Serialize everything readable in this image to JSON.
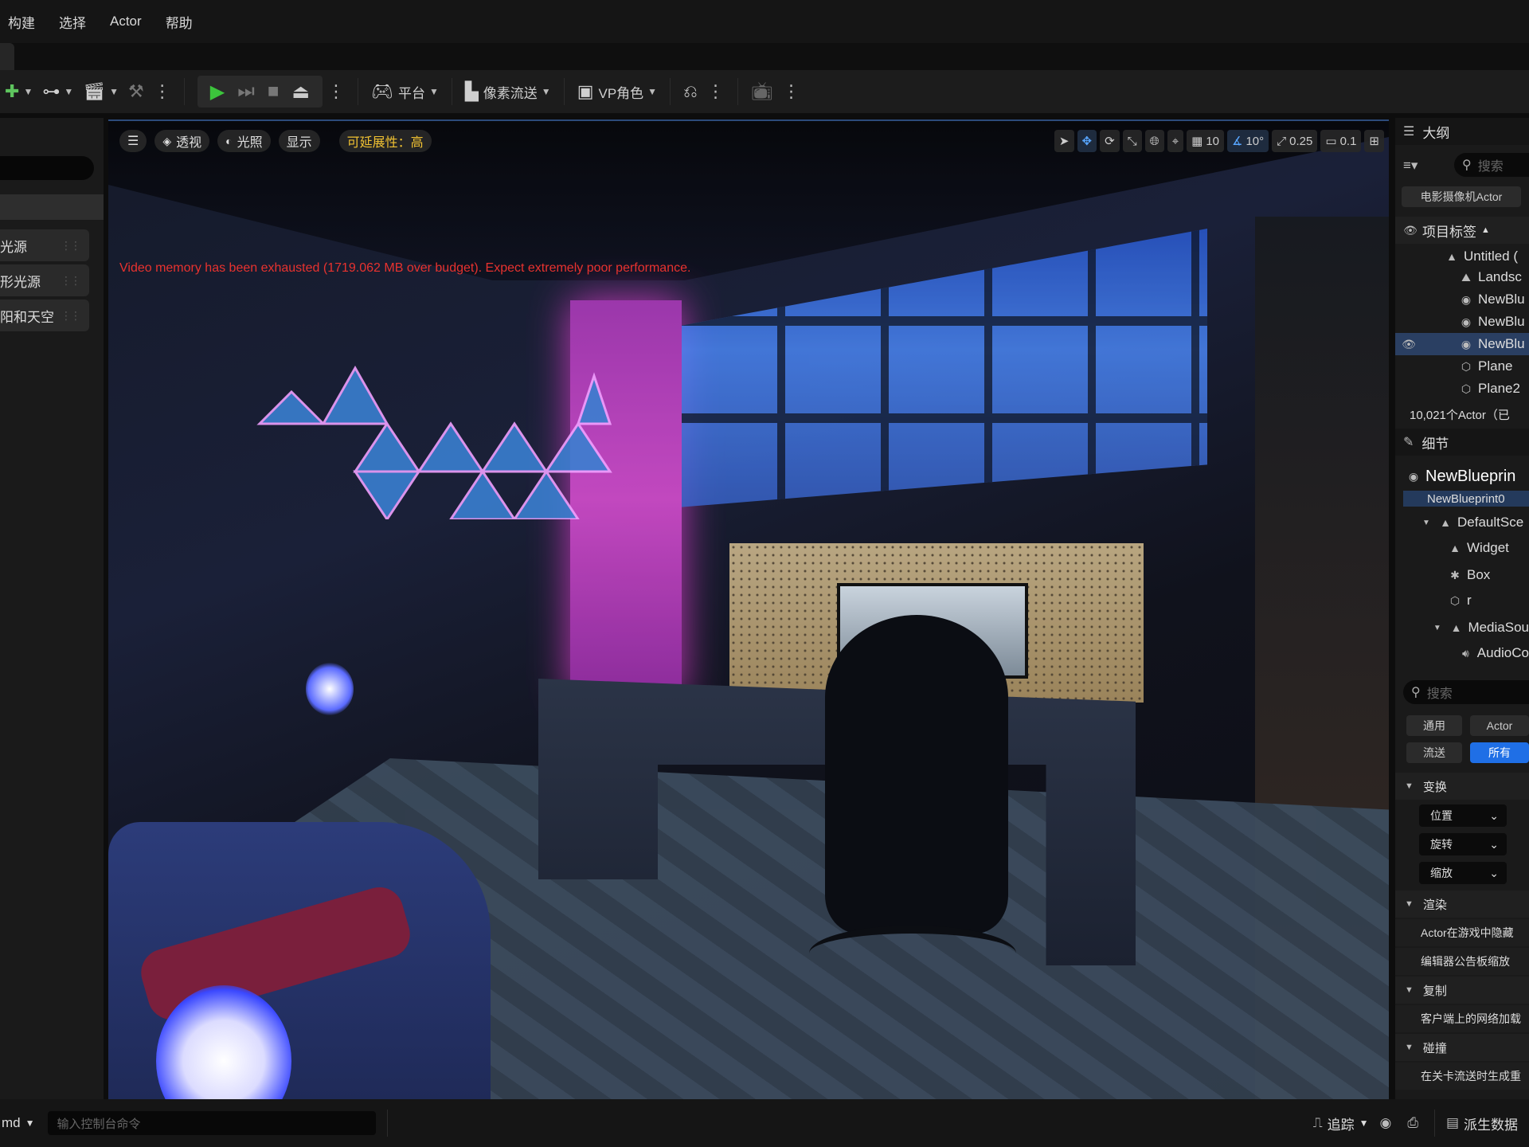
{
  "menu": [
    "构建",
    "选择",
    "Actor",
    "帮助"
  ],
  "toolbar": {
    "platform_label": "平台",
    "pixel_streaming_label": "像素流送",
    "vp_role_label": "VP角色"
  },
  "left_panel": {
    "items": [
      "光源",
      "形光源",
      "阳和天空"
    ]
  },
  "viewport": {
    "perspective_label": "透视",
    "lighting_label": "光照",
    "show_label": "显示",
    "scalability_label": "可延展性：高",
    "grid_snap": "10",
    "rotate_snap": "10°",
    "scale_snap": "0.25",
    "camera_speed": "0.1",
    "warning": "Video memory has been exhausted (1719.062 MB over budget). Expect extremely poor performance."
  },
  "outliner": {
    "title": "大纲",
    "search_placeholder": "搜索",
    "filter_chip": "电影摄像机Actor",
    "column_label": "项目标签",
    "rows": [
      {
        "label": "Untitled (",
        "icon": "level-icon"
      },
      {
        "label": "Landsc",
        "icon": "landscape-icon"
      },
      {
        "label": "NewBlu",
        "icon": "blueprint-icon"
      },
      {
        "label": "NewBlu",
        "icon": "blueprint-icon"
      },
      {
        "label": "NewBlu",
        "icon": "blueprint-icon"
      },
      {
        "label": "Plane",
        "icon": "mesh-icon"
      },
      {
        "label": "Plane2",
        "icon": "mesh-icon"
      }
    ],
    "actor_count": "10,021个Actor（已"
  },
  "details": {
    "title": "细节",
    "object_name": "NewBlueprin",
    "object_sub": "NewBlueprint0",
    "components": [
      {
        "label": "DefaultSce",
        "icon": "scene-icon"
      },
      {
        "label": "Widget",
        "icon": "widget-icon"
      },
      {
        "label": "Box",
        "icon": "box-icon"
      },
      {
        "label": "r",
        "icon": "mesh-icon"
      },
      {
        "label": "MediaSou",
        "icon": "media-icon"
      },
      {
        "label": "AudioCo",
        "icon": "audio-icon"
      }
    ],
    "search_placeholder": "搜索",
    "filters": [
      "通用",
      "Actor",
      "流送",
      "所有"
    ],
    "sections": {
      "transform": "变换",
      "location": "位置",
      "rotation": "旋转",
      "scale": "缩放",
      "rendering": "渲染",
      "hidden_in_game": "Actor在游戏中隐藏",
      "billboard_scale": "编辑器公告板缩放",
      "replication": "复制",
      "net_load": "客户端上的网络加载",
      "collision": "碰撞",
      "level_stream": "在关卡流送时生成重"
    }
  },
  "status": {
    "cmd_label": "md",
    "console_placeholder": "输入控制台命令",
    "trace_label": "追踪",
    "derived_data_label": "派生数据"
  },
  "colors": {
    "accent": "#1f6fe6",
    "warning": "#e8322f",
    "play_green": "#3cc43c",
    "scalability": "#f1c232"
  }
}
